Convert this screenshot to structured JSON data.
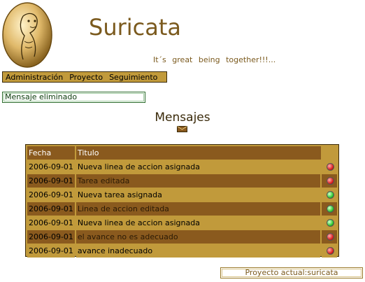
{
  "header": {
    "app_title": "Suricata",
    "tagline": "It´s  great  being  together!!!..."
  },
  "menu": {
    "items": [
      "Administración",
      "Proyecto",
      "Seguimiento"
    ]
  },
  "notice": "Mensaje eliminado",
  "messages": {
    "title": "Mensajes",
    "columns": {
      "date": "Fecha",
      "title": "Titulo"
    },
    "rows": [
      {
        "date": "2006-09-01",
        "title": "Nueva linea de accion asignada",
        "status": "red"
      },
      {
        "date": "2006-09-01",
        "title": "Tarea editada",
        "status": "red"
      },
      {
        "date": "2006-09-01",
        "title": "Nueva tarea asignada",
        "status": "green"
      },
      {
        "date": "2006-09-01",
        "title": "Linea de accion editada",
        "status": "green"
      },
      {
        "date": "2006-09-01",
        "title": "Nueva linea de accion asignada",
        "status": "green"
      },
      {
        "date": "2006-09-01",
        "title": "el avance no es adecuado",
        "status": "red"
      },
      {
        "date": "2006-09-01",
        "title": "avance inadecuado",
        "status": "red"
      }
    ]
  },
  "footer": {
    "current_project": "Proyecto actual:suricata"
  },
  "colors": {
    "accent": "#c19a3b",
    "dark_row": "#8a5a1e",
    "title": "#7b5a1e"
  }
}
